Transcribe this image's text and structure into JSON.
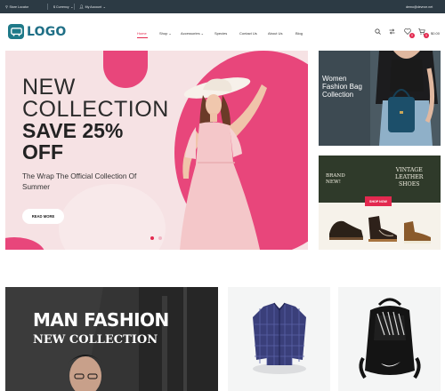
{
  "topbar": {
    "store_locator": "Store Locator",
    "currency": "$ Currency",
    "account": "My Account",
    "email": "demo@devnxe.net"
  },
  "header": {
    "logo_text": "LOGO",
    "nav": [
      "Home",
      "Shop",
      "Accessories",
      "Species",
      "Contact Us",
      "About Us",
      "Blog"
    ],
    "wishlist_count": "0",
    "cart_count": "0",
    "cart_total": "$0.00"
  },
  "hero": {
    "line1": "NEW",
    "line2": "COLLECTION",
    "line3": "SAVE 25%",
    "line4": "OFF",
    "subtitle": "The Wrap The Official Collection Of Summer",
    "button": "READ MORE",
    "slides": 2,
    "active_slide": 1
  },
  "banner_bag": {
    "line1": "Women",
    "line2": "Fashion Bag",
    "line3": "Collection"
  },
  "banner_shoes": {
    "brand": [
      "BRAND",
      "NEW!"
    ],
    "vintage": [
      "VINTAGE",
      "LEATHER",
      "SHOES"
    ],
    "button": "SHOP NOW"
  },
  "banner_man": {
    "line1": "MAN FASHION",
    "line2": "NEW COLLECTION"
  },
  "colors": {
    "accent": "#e3294f",
    "hero_pink": "#e8467b",
    "topbar": "#2c3a44",
    "logo": "#1f6f86"
  }
}
